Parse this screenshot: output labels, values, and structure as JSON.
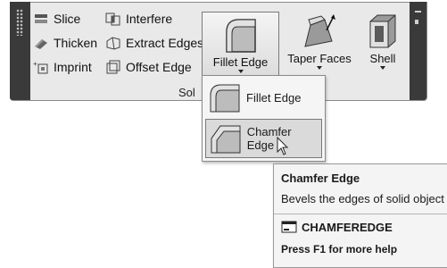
{
  "panel": {
    "title": "Sol",
    "small_items": [
      {
        "label": "Slice",
        "icon": "slice-icon"
      },
      {
        "label": "Thicken",
        "icon": "thicken-icon"
      },
      {
        "label": "Imprint",
        "icon": "imprint-icon"
      },
      {
        "label": "Interfere",
        "icon": "interfere-icon"
      },
      {
        "label": "Extract Edges",
        "icon": "extract-edges-icon"
      },
      {
        "label": "Offset Edge",
        "icon": "offset-edge-icon"
      }
    ],
    "big_buttons": {
      "fillet": "Fillet Edge",
      "taper": "Taper Faces",
      "shell": "Shell"
    }
  },
  "dropdown": {
    "items": [
      {
        "label": "Fillet Edge",
        "icon": "fillet-edge-icon"
      },
      {
        "label": "Chamfer Edge",
        "icon": "chamfer-edge-icon"
      }
    ]
  },
  "tooltip": {
    "title": "Chamfer Edge",
    "description": "Bevels the edges of solid object",
    "command": "CHAMFEREDGE",
    "help": "Press F1 for more help"
  }
}
